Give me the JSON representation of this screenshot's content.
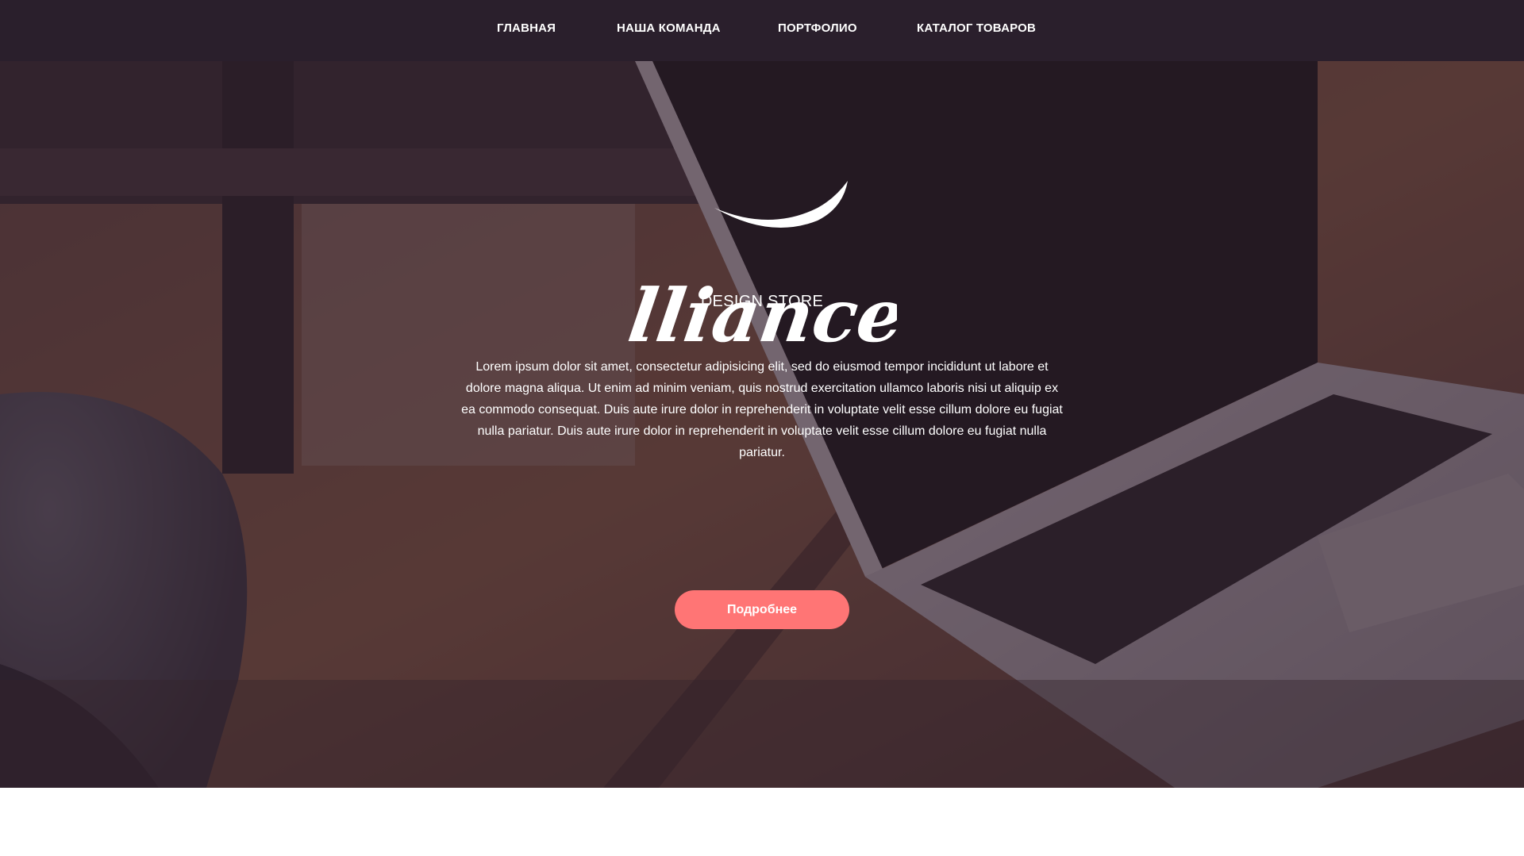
{
  "nav": {
    "items": [
      {
        "label": "ГЛАВНАЯ"
      },
      {
        "label": "НАША КОМАНДА"
      },
      {
        "label": "ПОРТФОЛИО"
      },
      {
        "label": "КАТАЛОГ ТОВАРОВ"
      }
    ]
  },
  "hero": {
    "logo_script": "Alliance",
    "logo_sub": "DESIGN STORE",
    "text": "Lorem ipsum dolor sit amet, consectetur adipisicing elit, sed do eiusmod tempor incididunt ut labore et dolore magna aliqua. Ut enim ad minim veniam, quis nostrud exercitation ullamco laboris nisi ut aliquip ex ea commodo consequat. Duis aute irure dolor in reprehenderit in voluptate velit esse cillum dolore eu fugiat nulla pariatur. Duis aute irure dolor in reprehenderit in voluptate velit esse cillum dolore eu fugiat nulla pariatur.",
    "button_label": "Подробнее"
  },
  "colors": {
    "navbar": "#2a1f2c",
    "accent": "#ff7575",
    "overlay": "#2c1e2c"
  }
}
